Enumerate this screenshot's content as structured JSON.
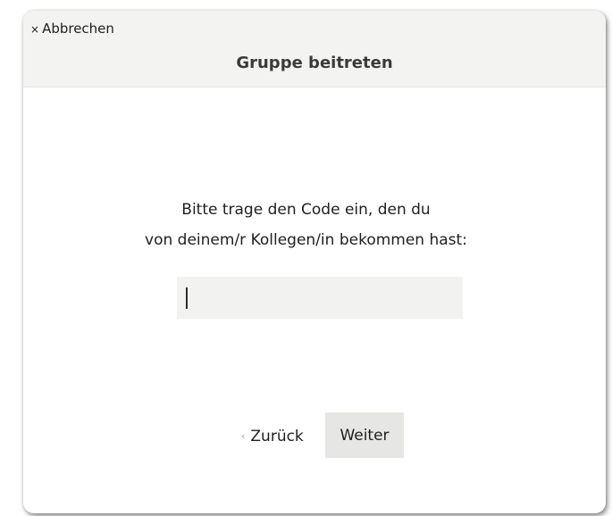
{
  "dialog": {
    "title": "Gruppe beitreten",
    "cancel_label": "Abbrechen",
    "cancel_icon": "close-icon"
  },
  "instruction": {
    "line1": "Bitte trage den Code ein, den du",
    "line2": "von deinem/r Kollegen/in bekommen hast:"
  },
  "code_field": {
    "value": ""
  },
  "footer": {
    "back_label": "Zurück",
    "back_icon": "chevron-left-icon",
    "next_label": "Weiter"
  }
}
